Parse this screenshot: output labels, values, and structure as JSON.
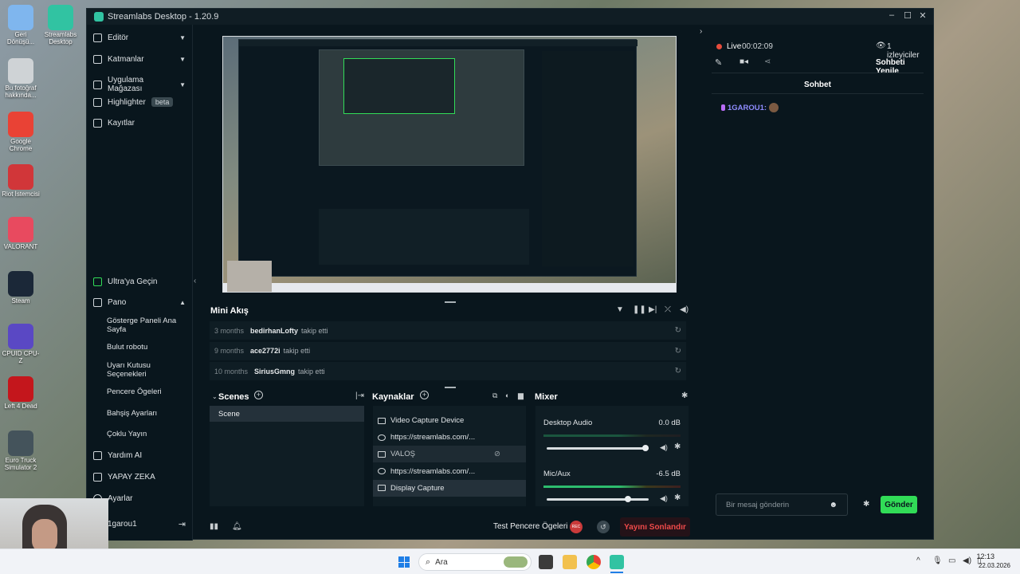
{
  "desktop": {
    "icons": [
      {
        "label": "Geri Dönüşü...",
        "icon": "recycle-bin-icon",
        "color": "#7fb6ee"
      },
      {
        "label": "Streamlabs Desktop",
        "icon": "streamlabs-icon",
        "color": "#31c3a2"
      },
      {
        "label": "Bu fotoğraf hakkında...",
        "icon": "camera-lens-icon",
        "color": "#cfd3d6"
      },
      {
        "label": "Google Chrome",
        "icon": "chrome-icon",
        "color": "#e94235"
      },
      {
        "label": "Riot İstemcisi",
        "icon": "riot-icon",
        "color": "#d13639"
      },
      {
        "label": "VALORANT",
        "icon": "valorant-icon",
        "color": "#e84a5f"
      },
      {
        "label": "Steam",
        "icon": "steam-icon",
        "color": "#1b2838"
      },
      {
        "label": "CPUID CPU-Z",
        "icon": "cpuz-icon",
        "color": "#5a48c4"
      },
      {
        "label": "Left 4 Dead",
        "icon": "left4dead-icon",
        "color": "#c4161c"
      },
      {
        "label": "Euro Truck Simulator 2",
        "icon": "truck-icon",
        "color": "#44535b"
      }
    ]
  },
  "window": {
    "title": "Streamlabs Desktop - 1.20.9"
  },
  "sidebar": {
    "items": [
      {
        "label": "Editör"
      },
      {
        "label": "Katmanlar"
      },
      {
        "label": "Uygulama Mağazası"
      },
      {
        "label": "Highlighter",
        "badge": "beta"
      },
      {
        "label": "Kayıtlar"
      }
    ],
    "ultra": "Ultra'ya Geçin",
    "pano": "Pano",
    "pano_items": [
      "Gösterge Paneli Ana Sayfa",
      "Bulut robotu",
      "Uyarı Kutusu Seçenekleri",
      "Pencere Ögeleri",
      "Bahşiş Ayarları",
      "Çoklu Yayın"
    ],
    "yardim": "Yardım AI",
    "yapay": "YAPAY ZEKA",
    "ayarlar": "Ayarlar",
    "user": "1garou1"
  },
  "mini_feed": {
    "title": "Mini Akış",
    "items": [
      {
        "time": "3 months",
        "user": "bedirhanLofty",
        "action": "takip etti"
      },
      {
        "time": "9 months",
        "user": "ace2772i",
        "action": "takip etti"
      },
      {
        "time": "10 months",
        "user": "SiriusGmng",
        "action": "takip etti"
      }
    ]
  },
  "scenes": {
    "title": "Scenes",
    "items": [
      "Scene"
    ]
  },
  "sources": {
    "title": "Kaynaklar",
    "items": [
      {
        "label": "Video Capture Device",
        "icon": "camera-icon"
      },
      {
        "label": "https://streamlabs.com/...",
        "icon": "globe-icon"
      },
      {
        "label": "VALOŞ",
        "icon": "eye-icon"
      },
      {
        "label": "https://streamlabs.com/...",
        "icon": "globe-icon"
      },
      {
        "label": "Display Capture",
        "icon": "monitor-icon"
      }
    ]
  },
  "mixer": {
    "title": "Mixer",
    "channels": [
      {
        "name": "Desktop Audio",
        "db": "0.0 dB",
        "level": 0.0,
        "volume": 0.97
      },
      {
        "name": "Mic/Aux",
        "db": "-6.5 dB",
        "level": 0.4,
        "volume": 0.8
      }
    ]
  },
  "footer": {
    "test_widgets": "Test Pencere Ögeleri",
    "rec": "REC",
    "end_stream": "Yayını Sonlandır"
  },
  "chat": {
    "live_label": "Live",
    "live_time": "00:02:09",
    "viewers": "1 izleyiciler",
    "refresh": "Sohbeti Yenile",
    "header": "Sohbet",
    "messages": [
      {
        "user": "1GAROU1:"
      }
    ],
    "input_placeholder": "Bir mesaj gönderin",
    "send": "Gönder"
  },
  "taskbar": {
    "search": "Ara",
    "time": "12:13",
    "date": "22.03.2026"
  }
}
